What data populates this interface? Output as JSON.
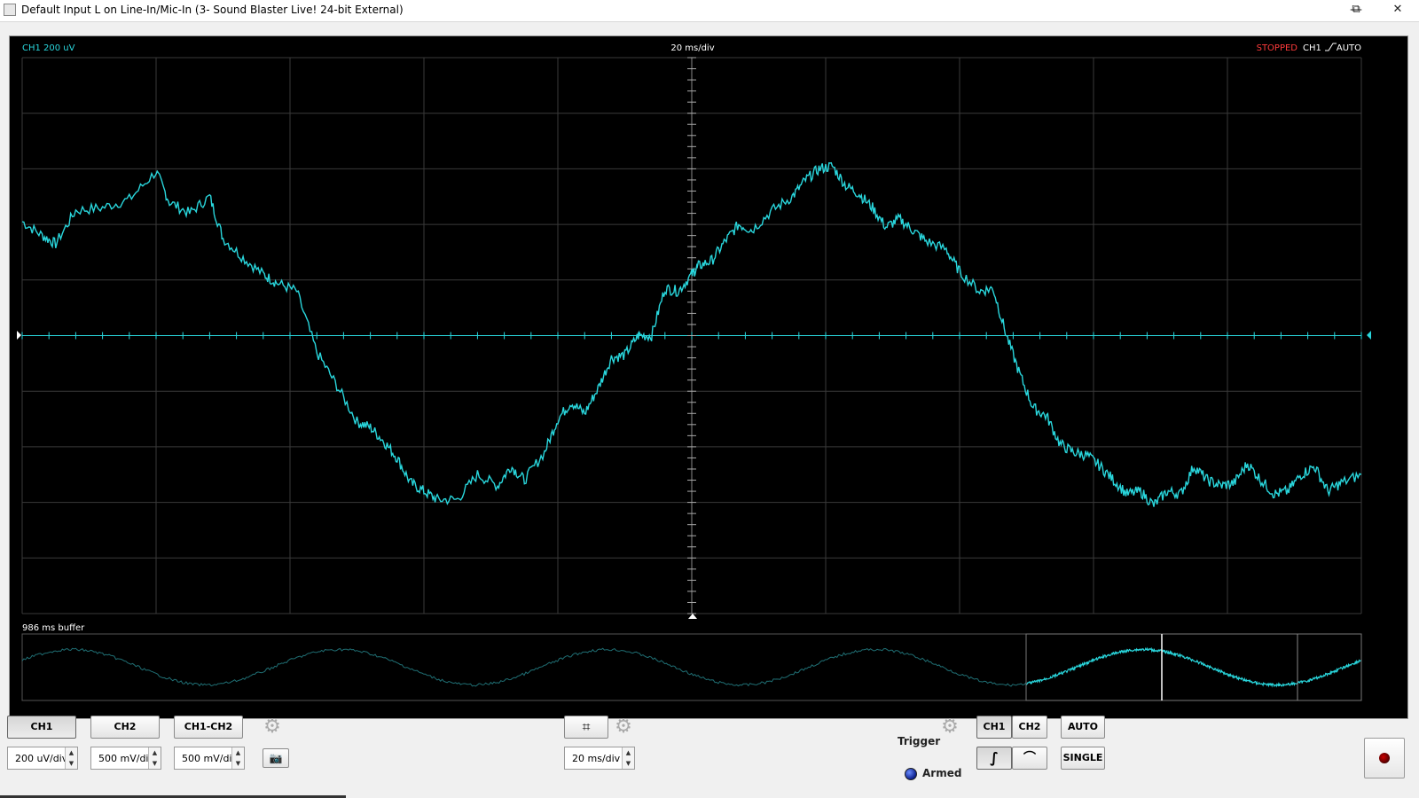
{
  "window": {
    "title": "Default Input L on Line-In/Mic-In (3- Sound Blaster Live! 24-bit External)",
    "minimize_glyph": "—",
    "maximize_glyph": "⧉",
    "close_glyph": "✕"
  },
  "scope": {
    "channel_label": "CH1 200 uV",
    "timebase_label": "20 ms/div",
    "status": "STOPPED",
    "trigger_channel": "CH1",
    "trigger_mode": "AUTO",
    "buffer_label": "986 ms buffer",
    "colors": {
      "trace": "#29d6dc",
      "grid": "#3a3a3a",
      "status": "#ff3b3b",
      "buffer_trace": "#1f6e73"
    }
  },
  "chart_data": {
    "type": "line",
    "xlabel": "",
    "ylabel": "",
    "title": "",
    "x_unit_per_div": "20 ms/div",
    "y_unit_per_div": "200 uV/div",
    "xlim": [
      -100,
      100
    ],
    "ylim": [
      -1000,
      1000
    ],
    "grid": true,
    "series": [
      {
        "x": [
          -100,
          -97,
          -95,
          -92,
          -88,
          -84,
          -80,
          -78,
          -75,
          -72,
          -70,
          -67,
          -64,
          -62,
          -59,
          -56,
          -53,
          -50,
          -48,
          -46,
          -44,
          -42,
          -40,
          -38,
          -35,
          -32,
          -29,
          -27,
          -25,
          -22,
          -20,
          -18,
          -16,
          -14,
          -12,
          -10,
          -8,
          -6,
          -4,
          -2,
          0,
          1,
          3,
          5,
          7,
          9,
          12,
          15,
          17,
          19,
          21,
          23,
          25,
          27,
          29,
          31,
          33,
          35,
          38,
          40,
          43,
          45,
          47,
          49,
          51,
          53,
          55,
          57,
          59,
          61,
          63,
          65,
          67,
          69,
          71,
          73,
          75,
          77,
          79,
          81,
          83,
          85,
          87,
          89,
          91,
          93,
          95,
          97,
          100
        ],
        "y": [
          410,
          360,
          330,
          450,
          460,
          490,
          590,
          480,
          440,
          500,
          350,
          280,
          220,
          190,
          160,
          -60,
          -180,
          -310,
          -330,
          -380,
          -440,
          -530,
          -560,
          -590,
          -590,
          -500,
          -540,
          -470,
          -520,
          -420,
          -300,
          -240,
          -280,
          -190,
          -80,
          -70,
          0,
          0,
          170,
          160,
          220,
          250,
          270,
          340,
          400,
          380,
          450,
          500,
          560,
          600,
          610,
          540,
          510,
          460,
          390,
          420,
          380,
          340,
          310,
          230,
          160,
          170,
          0,
          -140,
          -260,
          -290,
          -390,
          -420,
          -430,
          -470,
          -520,
          -570,
          -560,
          -610,
          -560,
          -570,
          -470,
          -520,
          -540,
          -530,
          -460,
          -520,
          -570,
          -560,
          -500,
          -470,
          -560,
          -530,
          -500
        ]
      }
    ]
  },
  "controls": {
    "ch1_label": "CH1",
    "ch2_label": "CH2",
    "diff_label": "CH1-CH2",
    "ch1_scale": "200 uV/div",
    "ch2_scale": "500 mV/div",
    "diff_scale": "500 mV/div",
    "timebase_value": "20 ms/div",
    "grid_glyph": "⌗",
    "camera_glyph": "📷",
    "gear_glyph": "⚙",
    "trigger_label": "Trigger",
    "trigger_ch1": "CH1",
    "trigger_ch2": "CH2",
    "auto_label": "AUTO",
    "single_label": "SINGLE",
    "armed_label": "Armed",
    "rising_glyph": "∫",
    "falling_glyph": "⌒",
    "up_arrow": "▲",
    "down_arrow": "▼"
  }
}
